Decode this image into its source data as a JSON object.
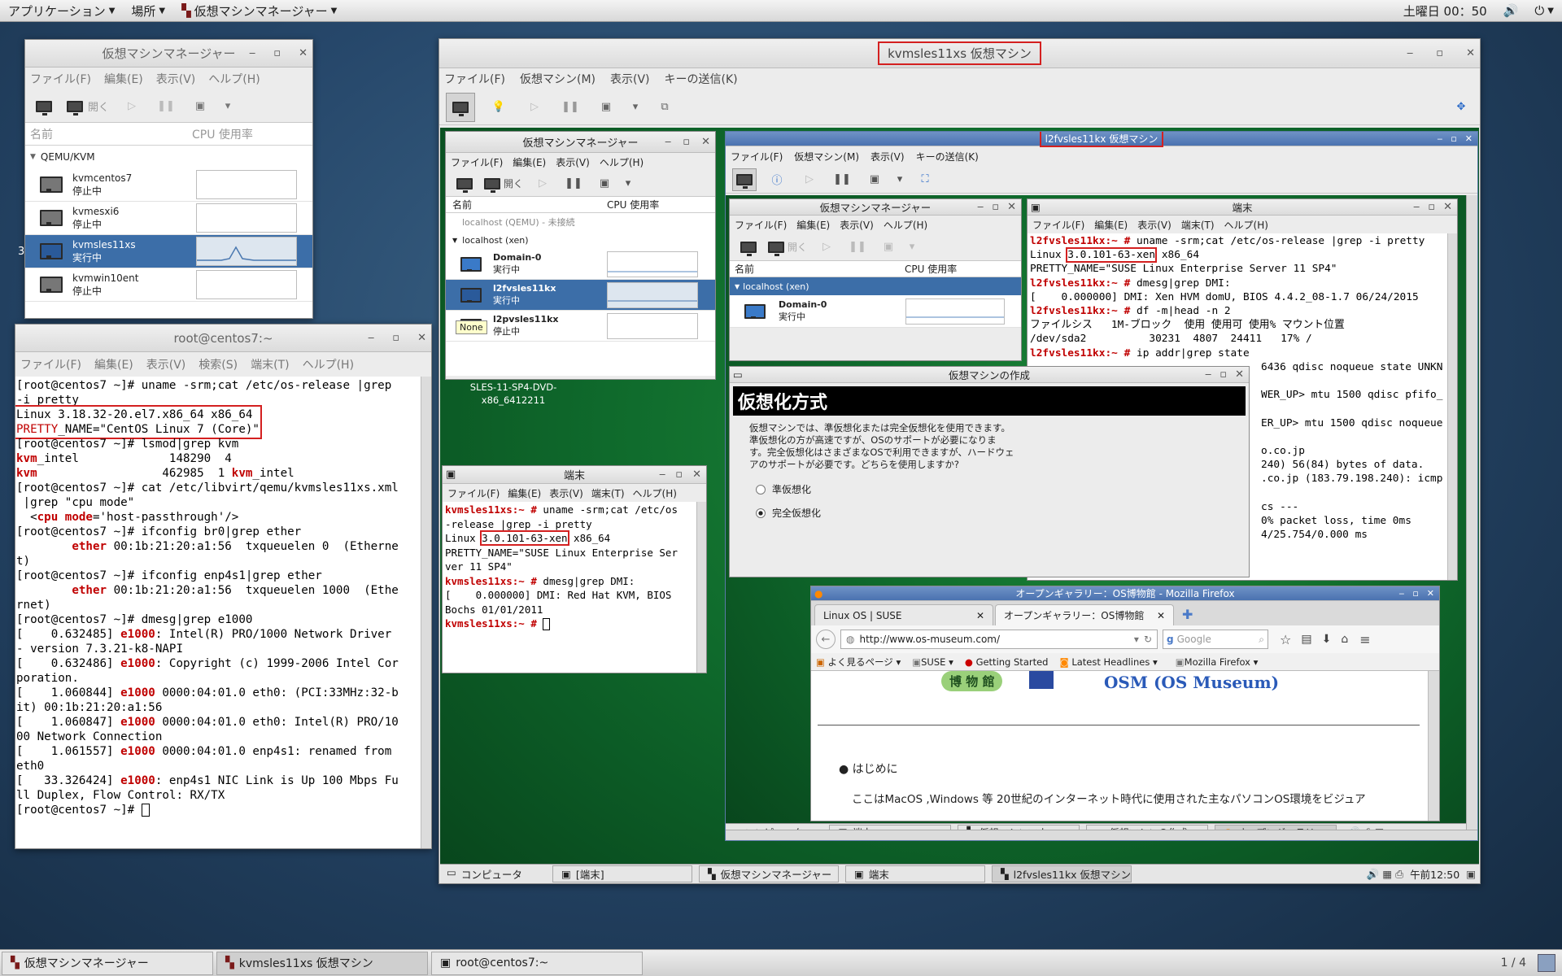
{
  "topbar": {
    "apps": "アプリケーション",
    "places": "場所",
    "vmm": "仮想マシンマネージャー",
    "clock": "土曜日 00：50",
    "power": "⏻"
  },
  "bottombar": {
    "tasks": [
      "仮想マシンマネージャー",
      "kvmsles11xs 仮想マシン",
      "root@centos7:~"
    ],
    "pager": "1 / 4"
  },
  "vmm_small": {
    "title": "仮想マシンマネージャー",
    "menu": [
      "ファイル(F)",
      "編集(E)",
      "表示(V)",
      "ヘルプ(H)"
    ],
    "open": "開く",
    "col_name": "名前",
    "col_cpu": "CPU 使用率",
    "group": "QEMU/KVM",
    "marker": "3",
    "vms": [
      {
        "name": "kvmcentos7",
        "state": "停止中"
      },
      {
        "name": "kvmesxi6",
        "state": "停止中"
      },
      {
        "name": "kvmsles11xs",
        "state": "実行中"
      },
      {
        "name": "kvmwin10ent",
        "state": "停止中"
      }
    ]
  },
  "term_root": {
    "title": "root@centos7:~",
    "menu": [
      "ファイル(F)",
      "編集(E)",
      "表示(V)",
      "検索(S)",
      "端末(T)",
      "ヘルプ(H)"
    ],
    "l1": "[root@centos7 ~]# uname -srm;cat /etc/os-release |grep",
    "l2": "-i pretty",
    "l3": "Linux 3.18.32-20.el7.x86_64 x86_64",
    "l4a": "PRETTY",
    "l4b": "_NAME=\"CentOS Linux 7 (Core)\"",
    "l5": "[root@centos7 ~]# lsmod|grep kvm",
    "l6a": "kvm",
    "l6b": "_intel             148290  4",
    "l7a": "kvm",
    "l7b": "                  462985  1 ",
    "l7c": "kvm",
    "l7d": "_intel",
    "l8": "[root@centos7 ~]# cat /etc/libvirt/qemu/kvmsles11xs.xml",
    "l9": " |grep \"cpu mode\"",
    "l10a": "  <",
    "l10b": "cpu mode",
    "l10c": "='host-passthrough'/>",
    "l11": "[root@centos7 ~]# ifconfig br0|grep ether",
    "l12a": "        ",
    "l12b": "ether",
    "l12c": " 00:1b:21:20:a1:56  txqueuelen 0  (Etherne",
    "l13": "t)",
    "l14": "[root@centos7 ~]# ifconfig enp4s1|grep ether",
    "l15a": "        ",
    "l15b": "ether",
    "l15c": " 00:1b:21:20:a1:56  txqueuelen 1000  (Ethe",
    "l16": "rnet)",
    "l17": "[root@centos7 ~]# dmesg|grep e1000",
    "l18a": "[    0.632485] ",
    "l18b": "e1000",
    "l18c": ": Intel(R) PRO/1000 Network Driver",
    "l19": "- version 7.3.21-k8-NAPI",
    "l20a": "[    0.632486] ",
    "l20b": "e1000",
    "l20c": ": Copyright (c) 1999-2006 Intel Cor",
    "l21": "poration.",
    "l22a": "[    1.060844] ",
    "l22b": "e1000",
    "l22c": " 0000:04:01.0 eth0: (PCI:33MHz:32-b",
    "l23": "it) 00:1b:21:20:a1:56",
    "l24a": "[    1.060847] ",
    "l24b": "e1000",
    "l24c": " 0000:04:01.0 eth0: Intel(R) PRO/10",
    "l25": "00 Network Connection",
    "l26a": "[    1.061557] ",
    "l26b": "e1000",
    "l26c": " 0000:04:01.0 enp4s1: renamed from",
    "l27": "eth0",
    "l28a": "[   33.326424] ",
    "l28b": "e1000",
    "l28c": ": enp4s1 NIC Link is Up 100 Mbps Fu",
    "l29": "ll Duplex, Flow Control: RX/TX",
    "l30": "[root@centos7 ~]# "
  },
  "kvm_win": {
    "title": "kvmsles11xs 仮想マシン",
    "menu": [
      "ファイル(F)",
      "仮想マシン(M)",
      "表示(V)",
      "キーの送信(K)"
    ],
    "inner_vmm": {
      "title": "仮想マシンマネージャー",
      "menu": [
        "ファイル(F)",
        "編集(E)",
        "表示(V)",
        "ヘルプ(H)"
      ],
      "open": "開く",
      "col_name": "名前",
      "col_cpu": "CPU 使用率",
      "conn1": "localhost (QEMU) - 未接続",
      "conn2": "localhost (xen)",
      "tooltip": "None",
      "vms": [
        {
          "name": "Domain-0",
          "state": "実行中"
        },
        {
          "name": "l2fvsles11kx",
          "state": "実行中"
        },
        {
          "name": "l2pvsles11kx",
          "state": "停止中"
        }
      ]
    },
    "dvd_label1": "SLES-11-SP4-DVD-",
    "dvd_label2": "x86_6412211",
    "inner_term": {
      "title": "端末",
      "menu": [
        "ファイル(F)",
        "編集(E)",
        "表示(V)",
        "端末(T)",
        "ヘルプ(H)"
      ],
      "p1": "kvmsles11xs:~ #",
      "c1": " uname -srm;cat /etc/os",
      "c1b": "-release |grep -i pretty",
      "l3a": "Linux ",
      "l3b": "3.0.101-63-xen",
      "l3c": " x86_64",
      "l4": "PRETTY_NAME=\"SUSE Linux Enterprise Ser",
      "l5": "ver 11 SP4\"",
      "p2": "kvmsles11xs:~ #",
      "c2": " dmesg|grep DMI:",
      "l7": "[    0.000000] DMI: Red Hat KVM, BIOS",
      "l8": "Bochs 01/01/2011",
      "p3": "kvmsles11xs:~ #"
    },
    "taskbar": {
      "computer": "コンピュータ",
      "items": [
        "[端末]",
        "仮想マシンマネージャー",
        "端末",
        "l2fvsles11kx 仮想マシン"
      ],
      "clock": "午前12:50"
    }
  },
  "l2_win": {
    "title": "l2fvsles11kx 仮想マシン",
    "menu": [
      "ファイル(F)",
      "仮想マシン(M)",
      "表示(V)",
      "キーの送信(K)"
    ],
    "vmm": {
      "title": "仮想マシンマネージャー",
      "menu": [
        "ファイル(F)",
        "編集(E)",
        "表示(V)",
        "ヘルプ(H)"
      ],
      "open": "開く",
      "col_name": "名前",
      "col_cpu": "CPU 使用率",
      "conn": "localhost (xen)",
      "vm": {
        "name": "Domain-0",
        "state": "実行中"
      }
    },
    "term": {
      "title": "端末",
      "menu": [
        "ファイル(F)",
        "編集(E)",
        "表示(V)",
        "端末(T)",
        "ヘルプ(H)"
      ],
      "p": "l2fvsles11kx:~ #",
      "c1": " uname -srm;cat /etc/os-release |grep -i pretty",
      "l2a": "Linux ",
      "l2b": "3.0.101-63-xen",
      "l2c": " x86_64",
      "l3": "PRETTY_NAME=\"SUSE Linux Enterprise Server 11 SP4\"",
      "c2": " dmesg|grep DMI:",
      "l5": "[    0.000000] DMI: Xen HVM domU, BIOS 4.4.2_08-1.7 06/24/2015",
      "c3": " df -m|head -n 2",
      "l7": "ファイルシス   1M-ブロック  使用 使用可 使用% マウント位置",
      "l8": "/dev/sda2          30231  4807  24411   17% /",
      "c4": " ip addr|grep state",
      "r1": "6436 qdisc noqueue state UNKN",
      "r2": "WER_UP> mtu 1500 qdisc pfifo_",
      "r3": "ER_UP> mtu 1500 qdisc noqueue",
      "r4": "o.co.jp",
      "r5": "240) 56(84) bytes of data.",
      "r6": ".co.jp (183.79.198.240): icmp",
      "r7": "cs ---",
      "r8": "0% packet loss, time 0ms",
      "r9": "4/25.754/0.000 ms"
    },
    "create": {
      "title": "仮想マシンの作成",
      "heading": "仮想化方式",
      "desc1": "仮想マシンでは、準仮想化または完全仮想化を使用できます。",
      "desc2": "準仮想化の方が高速ですが、OSのサポートが必要になりま",
      "desc3": "す。完全仮想化はさまざまなOSで利用できますが、ハードウェ",
      "desc4": "アのサポートが必要です。どちらを使用しますか?",
      "opt1": "準仮想化",
      "opt2": "完全仮想化"
    },
    "firefox": {
      "title": "オープンギャラリー：OS博物館 - Mozilla Firefox",
      "tab1": "Linux OS | SUSE",
      "tab2": "オープンギャラリー：OS博物館",
      "url": "http://www.os-museum.com/",
      "search": "Google",
      "bookmarks": [
        "よく見るページ",
        "SUSE",
        "Getting Started",
        "Latest Headlines",
        "Mozilla Firefox"
      ],
      "logo_text": "博 物 館",
      "heading": "OSM (OS Museum)",
      "bullet": "はじめに",
      "para": "ここはMacOS ,Windows 等 20世紀のインターネット時代に使用された主なパソコンOS環境をビジュア"
    },
    "taskbar": {
      "computer": "コンピュータ",
      "items": [
        "端末",
        "仮想マシンマネー...",
        "仮想マシンの作成",
        "オープンギャラリー..."
      ]
    }
  },
  "colors": {
    "accent": "#3c6ea8",
    "redbox": "#d42020",
    "prompt": "#c00000",
    "suse_green": "#0f6a2c"
  }
}
